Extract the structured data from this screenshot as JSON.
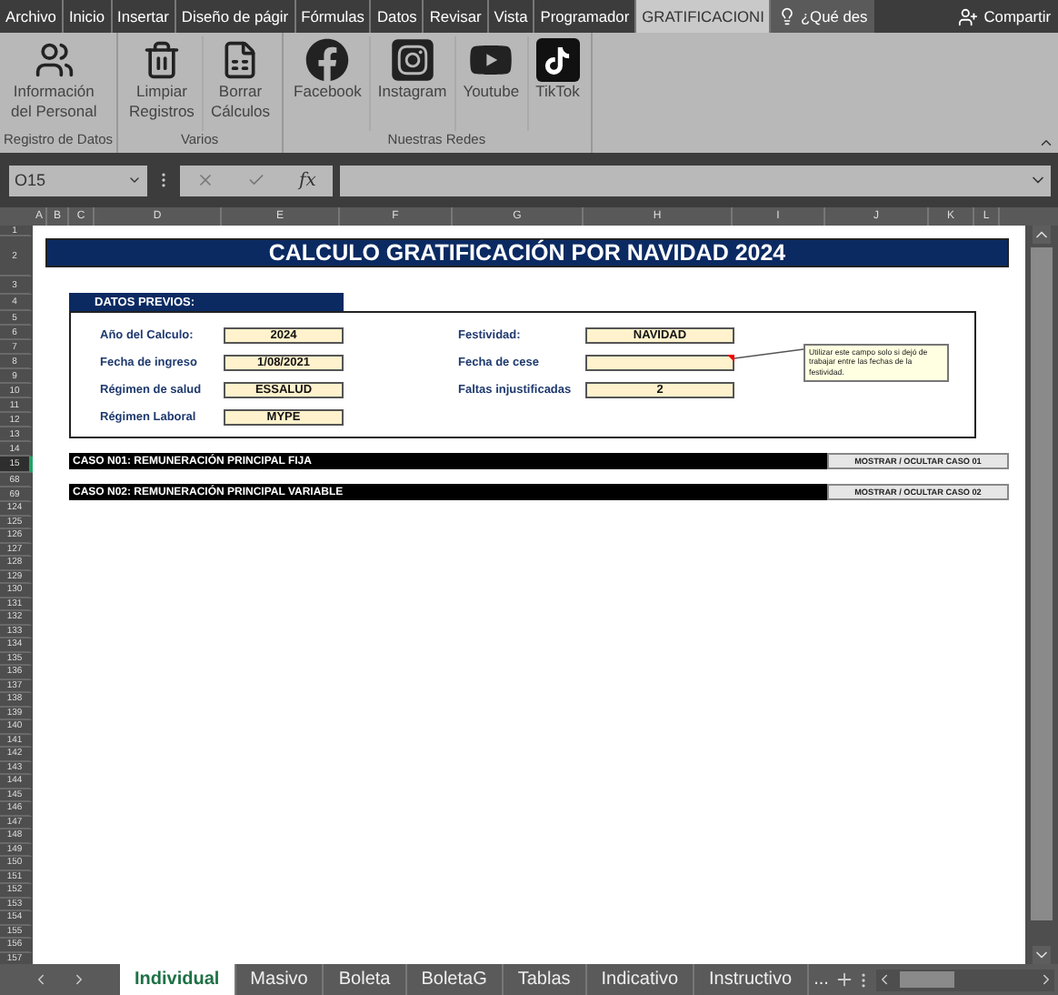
{
  "ribbon_tabs": [
    {
      "label": "Archivo",
      "selected": false
    },
    {
      "label": "Inicio",
      "selected": false
    },
    {
      "label": "Insertar",
      "selected": false
    },
    {
      "label": "Diseño de págir",
      "selected": false
    },
    {
      "label": "Fórmulas",
      "selected": false
    },
    {
      "label": "Datos",
      "selected": false
    },
    {
      "label": "Revisar",
      "selected": false
    },
    {
      "label": "Vista",
      "selected": false
    },
    {
      "label": "Programador",
      "selected": false
    },
    {
      "label": "GRATIFICACIONI",
      "selected": true
    }
  ],
  "tell_me": "¿Qué des",
  "share_button": "Compartir",
  "ribbon_groups": [
    {
      "label": "Registro de Datos",
      "buttons": [
        {
          "label": "Información\ndel Personal",
          "kind": "people"
        }
      ]
    },
    {
      "label": "Varios",
      "buttons": [
        {
          "label": "Limpiar\nRegistros",
          "kind": "trash"
        },
        {
          "label": "Borrar\nCálculos",
          "kind": "sheet"
        }
      ]
    },
    {
      "label": "Nuestras Redes",
      "buttons": [
        {
          "label": "Facebook",
          "kind": "facebook"
        },
        {
          "label": "Instagram",
          "kind": "instagram"
        },
        {
          "label": "Youtube",
          "kind": "youtube"
        },
        {
          "label": "TikTok",
          "kind": "tiktok"
        }
      ]
    }
  ],
  "name_box": "O15",
  "function_label": "fx",
  "columns": [
    "A",
    "B",
    "C",
    "D",
    "E",
    "F",
    "G",
    "H",
    "I",
    "J",
    "K",
    "L"
  ],
  "row_headers": [
    {
      "label": "1",
      "selected": false
    },
    {
      "label": "2",
      "selected": false
    },
    {
      "label": "3",
      "selected": false
    },
    {
      "label": "4",
      "selected": false
    },
    {
      "label": "5",
      "selected": false
    },
    {
      "label": "6",
      "selected": false
    },
    {
      "label": "7",
      "selected": false
    },
    {
      "label": "8",
      "selected": false
    },
    {
      "label": "9",
      "selected": false
    },
    {
      "label": "10",
      "selected": false
    },
    {
      "label": "11",
      "selected": false
    },
    {
      "label": "12",
      "selected": false
    },
    {
      "label": "13",
      "selected": false
    },
    {
      "label": "14",
      "selected": false
    },
    {
      "label": "15",
      "selected": true
    },
    {
      "label": "68",
      "selected": false
    },
    {
      "label": "69",
      "selected": false
    },
    {
      "label": "124",
      "selected": false
    },
    {
      "label": "125",
      "selected": false
    },
    {
      "label": "126",
      "selected": false
    },
    {
      "label": "127",
      "selected": false
    },
    {
      "label": "128",
      "selected": false
    },
    {
      "label": "129",
      "selected": false
    },
    {
      "label": "130",
      "selected": false
    },
    {
      "label": "131",
      "selected": false
    },
    {
      "label": "132",
      "selected": false
    },
    {
      "label": "133",
      "selected": false
    },
    {
      "label": "134",
      "selected": false
    },
    {
      "label": "135",
      "selected": false
    },
    {
      "label": "136",
      "selected": false
    },
    {
      "label": "137",
      "selected": false
    },
    {
      "label": "138",
      "selected": false
    },
    {
      "label": "139",
      "selected": false
    },
    {
      "label": "140",
      "selected": false
    },
    {
      "label": "141",
      "selected": false
    },
    {
      "label": "142",
      "selected": false
    },
    {
      "label": "143",
      "selected": false
    },
    {
      "label": "144",
      "selected": false
    },
    {
      "label": "145",
      "selected": false
    },
    {
      "label": "146",
      "selected": false
    },
    {
      "label": "147",
      "selected": false
    },
    {
      "label": "148",
      "selected": false
    },
    {
      "label": "149",
      "selected": false
    },
    {
      "label": "150",
      "selected": false
    },
    {
      "label": "151",
      "selected": false
    },
    {
      "label": "152",
      "selected": false
    },
    {
      "label": "153",
      "selected": false
    },
    {
      "label": "154",
      "selected": false
    },
    {
      "label": "155",
      "selected": false
    },
    {
      "label": "156",
      "selected": false
    },
    {
      "label": "157",
      "selected": false
    }
  ],
  "sheet": {
    "title": "CALCULO GRATIFICACIÓN POR NAVIDAD 2024",
    "section_title": "DATOS PREVIOS:",
    "fields_left": [
      {
        "label": "Año del Calculo:",
        "value": "2024",
        "has_comment": false
      },
      {
        "label": "Fecha de ingreso",
        "value": "1/08/2021",
        "has_comment": false
      },
      {
        "label": "Régimen de salud",
        "value": "ESSALUD",
        "has_comment": false
      },
      {
        "label": "Régimen Laboral",
        "value": "MYPE",
        "has_comment": false
      }
    ],
    "fields_right": [
      {
        "label": "Festividad:",
        "value": "NAVIDAD",
        "has_comment": false
      },
      {
        "label": "Fecha de cese",
        "has_comment": true
      },
      {
        "label": "Faltas injustificadas",
        "value": "2",
        "has_comment": false
      }
    ],
    "comment": "Utilizar este campo solo si dejó de trabajar entre las fechas de la festividad.",
    "cases": [
      {
        "title": "CASO N01: REMUNERACIÓN PRINCIPAL FIJA",
        "button": "MOSTRAR / OCULTAR CASO 01"
      },
      {
        "title": "CASO N02: REMUNERACIÓN PRINCIPAL VARIABLE",
        "button": "MOSTRAR / OCULTAR CASO 02"
      }
    ]
  },
  "sheet_tabs": [
    {
      "label": "Individual",
      "selected": true
    },
    {
      "label": "Masivo",
      "selected": false
    },
    {
      "label": "Boleta",
      "selected": false
    },
    {
      "label": "BoletaG",
      "selected": false
    },
    {
      "label": "Tablas",
      "selected": false
    },
    {
      "label": "Indicativo",
      "selected": false
    },
    {
      "label": "Instructivo",
      "selected": false
    }
  ],
  "more_tabs": "..."
}
